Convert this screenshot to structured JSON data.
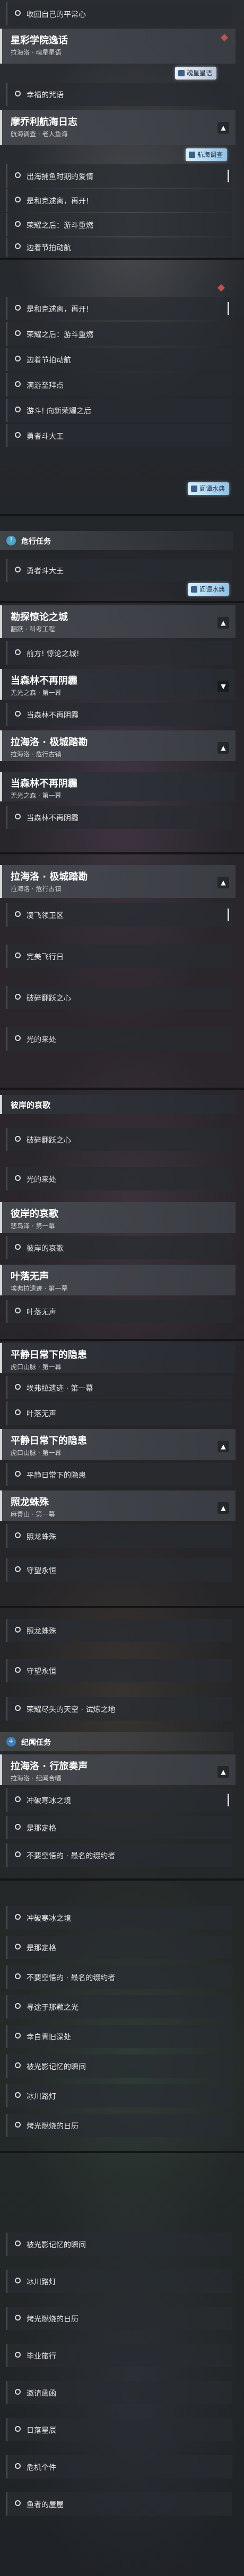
{
  "screens": [
    {
      "items": [
        {
          "kind": "step",
          "label": "收回自己的平常心"
        },
        {
          "kind": "header",
          "title": "星彩学院逸话",
          "subtitle": "拉海洛 · 魂星星语",
          "badge": "魂星星语",
          "diamond": true
        },
        {
          "kind": "step",
          "label": "幸福的咒语"
        },
        {
          "kind": "header",
          "title": "摩乔利航海日志",
          "subtitle": "航海调查 · 老人鱼海",
          "badge": "航海调查"
        },
        {
          "kind": "step",
          "label": "出海捕鱼时期的爱情"
        },
        {
          "kind": "step",
          "label": "是和克逑离，再开!"
        },
        {
          "kind": "step",
          "label": "荣耀之后：游斗重燃"
        },
        {
          "kind": "step",
          "label": "边着节拍动航"
        }
      ]
    },
    {
      "items": [
        {
          "kind": "step",
          "label": "是和克逑离，再开!"
        },
        {
          "kind": "step",
          "label": "荣耀之后：游斗重燃"
        },
        {
          "kind": "step",
          "label": "边着节拍动航"
        },
        {
          "kind": "step",
          "label": "满游至拜点"
        },
        {
          "kind": "step",
          "label": "游斗! 向新荣耀之后"
        },
        {
          "kind": "step",
          "label": "勇者斗大王"
        },
        {
          "kind": "header_small",
          "badge": "阎谭水典"
        }
      ],
      "diamond": true
    },
    {
      "items": [
        {
          "kind": "category",
          "label": "危行任务",
          "icon": "!"
        },
        {
          "kind": "step",
          "label": "勇者斗大王"
        },
        {
          "kind": "header_small",
          "badge": "阎谭水典"
        }
      ]
    },
    {
      "items": [
        {
          "kind": "header",
          "title": "勘探惊论之城",
          "subtitle": "翻跃 · 科考工程"
        },
        {
          "kind": "step",
          "label": "前方! 惊论之城!"
        },
        {
          "kind": "header",
          "title": "当森林不再阴霾",
          "subtitle": "无光之森 · 第一幕"
        },
        {
          "kind": "step",
          "label": "当森林不再阴霾"
        },
        {
          "kind": "header",
          "title": "拉海洛 · 极城踏勘",
          "subtitle": "拉海洛 · 危行古镇"
        },
        {
          "kind": "header_partial",
          "title": "当森林不再阴霾",
          "subtitle": "无光之森 · 第一幕"
        },
        {
          "kind": "step",
          "label": "当森林不再阴霾"
        }
      ]
    },
    {
      "items": [
        {
          "kind": "header",
          "title": "拉海洛 · 极城踏勘",
          "subtitle": "拉海洛 · 危行古镇"
        },
        {
          "kind": "step",
          "label": "凌飞领卫区"
        },
        {
          "kind": "step",
          "label": "完美飞行日"
        },
        {
          "kind": "step",
          "label": "破碎翻跃之心"
        },
        {
          "kind": "step",
          "label": "光的来处"
        }
      ]
    },
    {
      "items": [
        {
          "kind": "header_plain",
          "title": "彼岸的哀歌"
        },
        {
          "kind": "step",
          "label": "破碎翻跃之心"
        },
        {
          "kind": "step",
          "label": "光的来处"
        },
        {
          "kind": "header",
          "title": "彼岸的哀歌",
          "subtitle": "悲鸟泽 · 第一幕"
        },
        {
          "kind": "step",
          "label": "彼岸的哀歌"
        },
        {
          "kind": "header",
          "title": "叶落无声",
          "subtitle": "埃弗拉遗迹 · 第一幕"
        },
        {
          "kind": "step",
          "label": "叶落无声"
        }
      ]
    },
    {
      "items": [
        {
          "kind": "header",
          "title": "平静日常下的隐患",
          "subtitle": "虎口山脉 · 第一幕"
        },
        {
          "kind": "step",
          "label": "埃弗拉遗迹 · 第一幕"
        },
        {
          "kind": "step",
          "label": "叶落无声"
        },
        {
          "kind": "header",
          "title": "平静日常下的隐患",
          "subtitle": "虎口山脉 · 第一幕"
        },
        {
          "kind": "step",
          "label": "平静日常下的隐患"
        },
        {
          "kind": "header",
          "title": "照龙蛛殊",
          "subtitle": "麻青山 · 第一幕"
        },
        {
          "kind": "step",
          "label": "照龙蛛殊"
        },
        {
          "kind": "step",
          "label": "守望永恒"
        }
      ]
    },
    {
      "items": [
        {
          "kind": "step",
          "label": "照龙蛛殊"
        },
        {
          "kind": "step",
          "label": "守望永恒"
        },
        {
          "kind": "step",
          "label": "荣耀尽头的天空 · 试炼之地"
        },
        {
          "kind": "category",
          "label": "纪闻任务",
          "icon": "+"
        },
        {
          "kind": "header",
          "title": "拉海洛 · 行旅奏声",
          "subtitle": "拉海洛 · 纪闻合唱"
        },
        {
          "kind": "step",
          "label": "冲破寒冰之境"
        },
        {
          "kind": "step",
          "label": "是那定格"
        },
        {
          "kind": "step",
          "label": "不要空悟的 · 最名的缀约者"
        }
      ]
    },
    {
      "items": [
        {
          "kind": "step",
          "label": "冲破寒冰之境"
        },
        {
          "kind": "step",
          "label": "是那定格"
        },
        {
          "kind": "step",
          "label": "不要空悟的 · 最名的缀约者"
        },
        {
          "kind": "step",
          "label": "寻途于那颗之光"
        },
        {
          "kind": "step",
          "label": "幸自青旧深处"
        },
        {
          "kind": "step",
          "label": "被光影记忆的瞬间"
        },
        {
          "kind": "step",
          "label": "冰川路灯"
        },
        {
          "kind": "step",
          "label": "烤光燃烧的日历"
        }
      ]
    },
    {
      "items": [
        {
          "kind": "step",
          "label": "被光影记忆的瞬间"
        },
        {
          "kind": "step",
          "label": "冰川路灯"
        },
        {
          "kind": "step",
          "label": "烤光燃烧的日历"
        },
        {
          "kind": "step",
          "label": "毕业旅行"
        },
        {
          "kind": "step",
          "label": "邀请函函"
        },
        {
          "kind": "step",
          "label": "日落星辰"
        },
        {
          "kind": "step",
          "label": "危机个件"
        },
        {
          "kind": "step",
          "label": "鱼者的屋屋"
        }
      ]
    }
  ]
}
